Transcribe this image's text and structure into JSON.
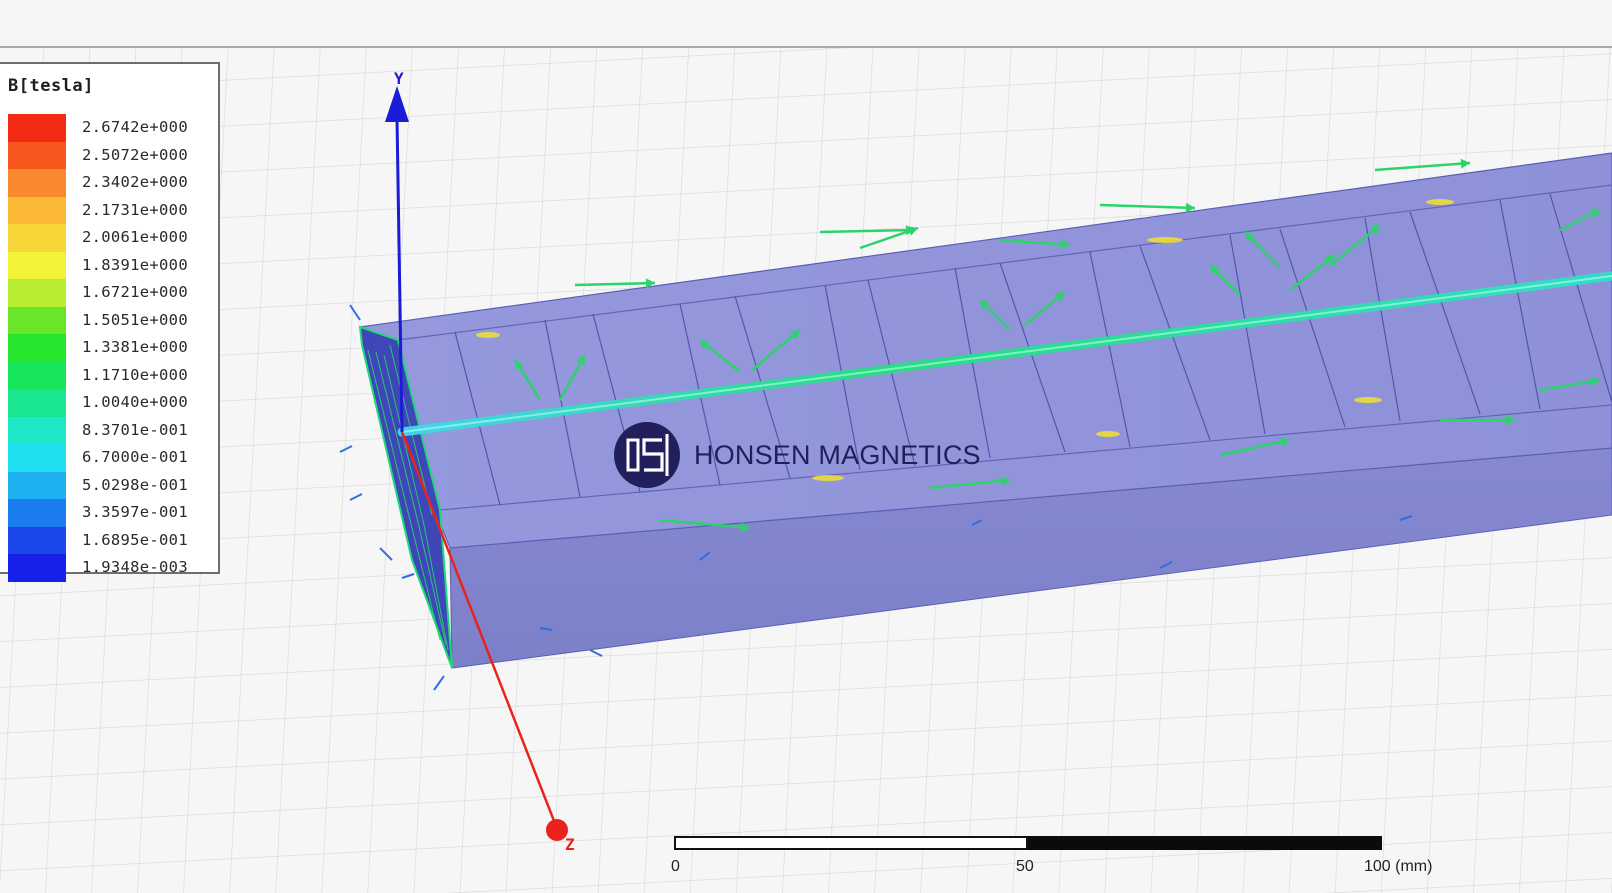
{
  "legend": {
    "title": "B[tesla]",
    "rows": [
      {
        "value": "2.6742e+000",
        "color": "#f52a14"
      },
      {
        "value": "2.5072e+000",
        "color": "#f7561c"
      },
      {
        "value": "2.3402e+000",
        "color": "#f9882e"
      },
      {
        "value": "2.1731e+000",
        "color": "#fbb935"
      },
      {
        "value": "2.0061e+000",
        "color": "#f8d63a"
      },
      {
        "value": "1.8391e+000",
        "color": "#f2f336"
      },
      {
        "value": "1.6721e+000",
        "color": "#b8ec2e"
      },
      {
        "value": "1.5051e+000",
        "color": "#6ae52a"
      },
      {
        "value": "1.3381e+000",
        "color": "#25e62c"
      },
      {
        "value": "1.1710e+000",
        "color": "#17e65a"
      },
      {
        "value": "1.0040e+000",
        "color": "#1ae690"
      },
      {
        "value": "8.3701e-001",
        "color": "#1de8c7"
      },
      {
        "value": "6.7000e-001",
        "color": "#20dff0"
      },
      {
        "value": "5.0298e-001",
        "color": "#1eb0f0"
      },
      {
        "value": "3.3597e-001",
        "color": "#1a7cee"
      },
      {
        "value": "1.6895e-001",
        "color": "#1a48ea"
      },
      {
        "value": "1.9348e-003",
        "color": "#1620e8"
      }
    ]
  },
  "axes": {
    "y_label": "Y",
    "z_label": "Z",
    "y_color": "#1b1bd8",
    "z_color": "#e8231b"
  },
  "watermark": {
    "text": "HONSEN MAGNETICS",
    "logo_icon": "honsen-logo-icon"
  },
  "scale_bar": {
    "labels": [
      "0",
      "50",
      "100 (mm)"
    ]
  },
  "model": {
    "body_color": "#8c8fd6",
    "field_vector_color": "#2bd46a",
    "core_line_color": "#2fe0b8"
  }
}
